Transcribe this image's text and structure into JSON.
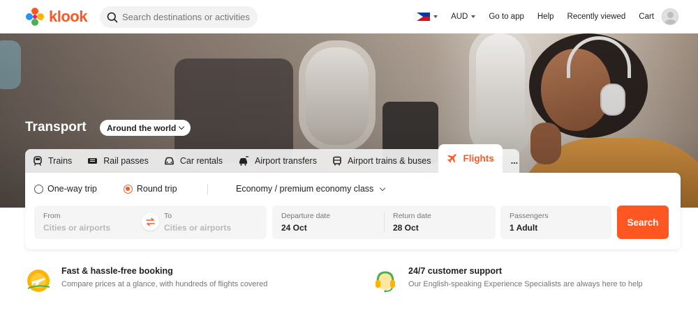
{
  "header": {
    "logo_text": "klook",
    "search_placeholder": "Search destinations or activities",
    "nav": {
      "currency": "AUD",
      "go_to_app": "Go to app",
      "help": "Help",
      "recently_viewed": "Recently viewed",
      "cart": "Cart"
    }
  },
  "hero": {
    "title": "Transport",
    "region_selector": "Around the world"
  },
  "tabs": [
    {
      "label": "Trains",
      "icon": "train-icon"
    },
    {
      "label": "Rail passes",
      "icon": "ticket-icon"
    },
    {
      "label": "Car rentals",
      "icon": "car-icon"
    },
    {
      "label": "Airport transfers",
      "icon": "car-transfer-icon"
    },
    {
      "label": "Airport trains & buses",
      "icon": "bus-icon"
    },
    {
      "label": "Flights",
      "icon": "plane-icon",
      "active": true
    },
    {
      "label": "...",
      "icon": "more-icon"
    }
  ],
  "search_panel": {
    "trip_types": [
      {
        "label": "One-way trip",
        "selected": false
      },
      {
        "label": "Round trip",
        "selected": true
      }
    ],
    "cabin_class": "Economy / premium economy class",
    "from": {
      "label": "From",
      "placeholder": "Cities or airports"
    },
    "to": {
      "label": "To",
      "placeholder": "Cities or airports"
    },
    "departure": {
      "label": "Departure date",
      "value": "24 Oct"
    },
    "return": {
      "label": "Return date",
      "value": "28 Oct"
    },
    "passengers": {
      "label": "Passengers",
      "value": "1 Adult"
    },
    "search_button": "Search"
  },
  "features": [
    {
      "title": "Fast & hassle-free booking",
      "desc": "Compare prices at a glance, with hundreds of flights covered",
      "icon": "plane-badge-icon"
    },
    {
      "title": "24/7 customer support",
      "desc": "Our English-speaking Experience Specialists are always here to help",
      "icon": "headset-icon"
    }
  ],
  "colors": {
    "brand": "#ff5722",
    "text": "#212121",
    "muted": "#757575"
  }
}
